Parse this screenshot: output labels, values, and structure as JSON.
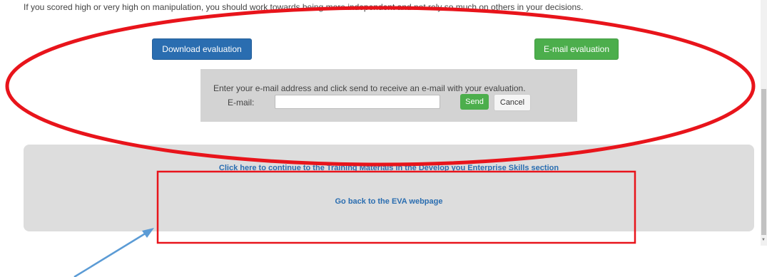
{
  "intro_text": "If you scored high or very high on manipulation, you should work towards being more independent and not rely so much on others in your decisions.",
  "buttons": {
    "download": "Download evaluation",
    "email": "E-mail evaluation"
  },
  "email_form": {
    "instruction": "Enter your e-mail address and click send to receive an e-mail with your evaluation.",
    "label": "E-mail:",
    "value": "",
    "send": "Send",
    "cancel": "Cancel"
  },
  "links": {
    "training": "Click here to continue to the Training Materials in the Develop you Enterprise Skills section",
    "eva": "Go back to the EVA webpage"
  },
  "annotation_colors": {
    "ellipse": "#e8141b",
    "rectangle": "#e8141b",
    "arrow": "#5b9bd5"
  }
}
